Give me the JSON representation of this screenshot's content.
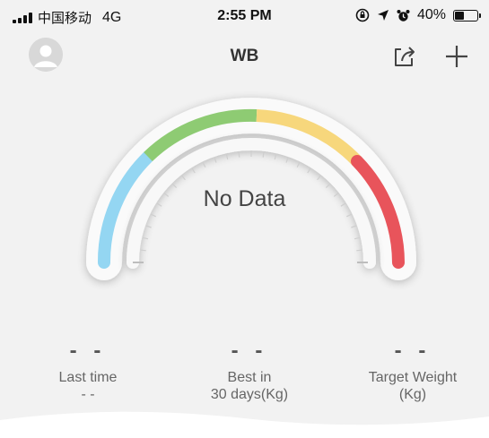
{
  "status_bar": {
    "carrier": "中国移动",
    "network": "4G",
    "time": "2:55 PM",
    "battery_percent": "40%",
    "battery_level": 0.4
  },
  "nav": {
    "title": "WB",
    "avatar_icon": "user-avatar-icon",
    "share_icon": "share-icon",
    "add_icon": "plus-icon"
  },
  "gauge": {
    "status_text": "No Data",
    "segment_colors": [
      "#94d6f2",
      "#8ecb73",
      "#f7d77c",
      "#e8545b"
    ]
  },
  "stats": {
    "last_time": {
      "value": "- -",
      "label": "Last time",
      "sub": "- -"
    },
    "best_30_days": {
      "value": "- -",
      "label": "Best in",
      "sub": "30 days(Kg)"
    },
    "target_weight": {
      "value": "- -",
      "label": "Target Weight",
      "sub": "(Kg)"
    }
  }
}
